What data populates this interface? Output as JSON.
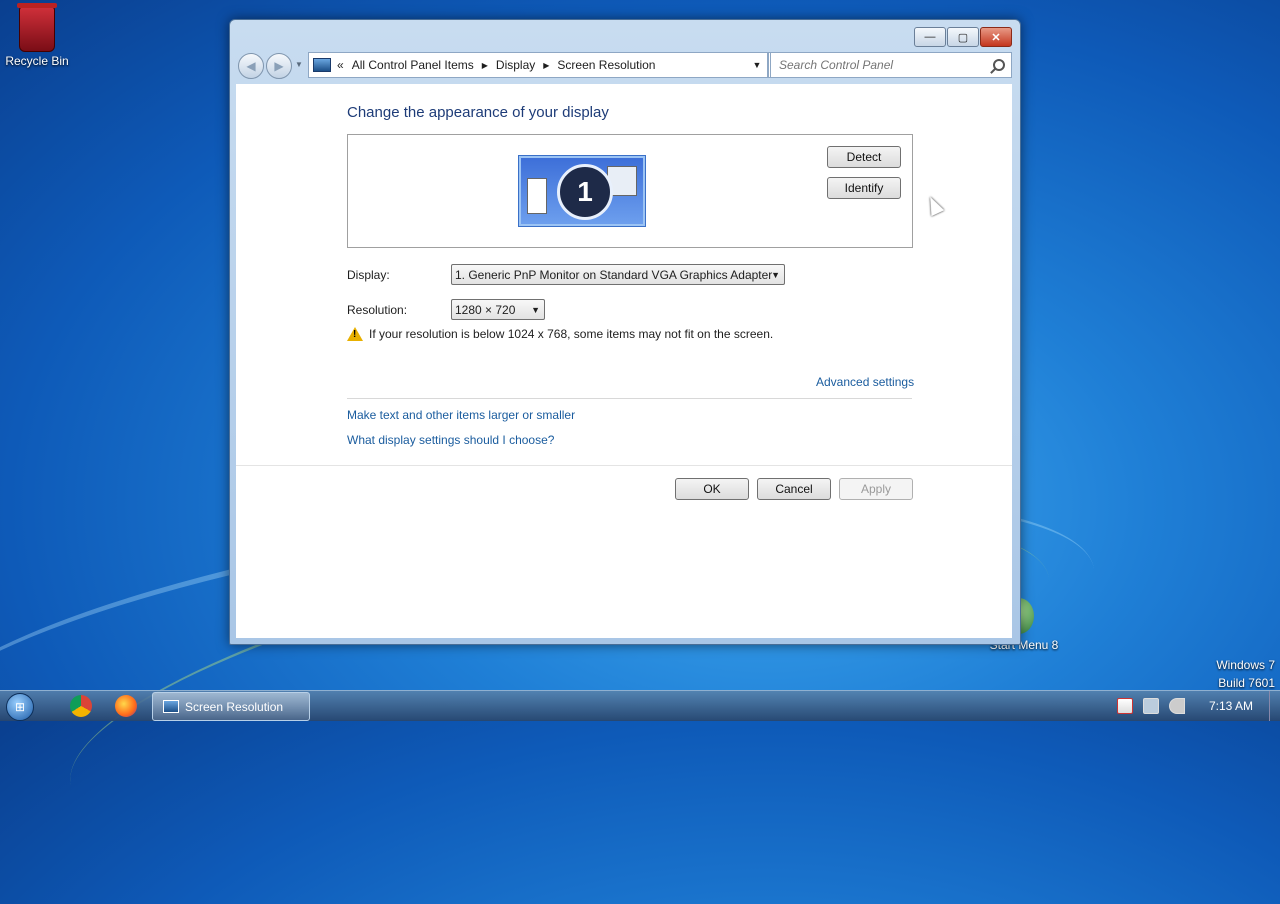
{
  "desktop": {
    "recycle_bin_label": "Recycle Bin",
    "start_menu_label": "Start Menu 8",
    "os_name": "Windows 7",
    "os_build": "Build 7601"
  },
  "window": {
    "caption_buttons": {
      "minimize": "—",
      "maximize": "▢",
      "close": "✕"
    },
    "address": {
      "prefix": "«",
      "segments": [
        "All Control Panel Items",
        "Display",
        "Screen Resolution"
      ]
    },
    "search_placeholder": "Search Control Panel"
  },
  "page": {
    "heading": "Change the appearance of your display",
    "monitor_number": "1",
    "detect_label": "Detect",
    "identify_label": "Identify",
    "display_label": "Display:",
    "display_value": "1. Generic PnP Monitor on Standard VGA Graphics Adapter",
    "resolution_label": "Resolution:",
    "resolution_value": "1280 × 720",
    "warning_text": "If your resolution is below 1024 x 768, some items may not fit on the screen.",
    "advanced_link": "Advanced settings",
    "link_text_size": "Make text and other items larger or smaller",
    "link_help": "What display settings should I choose?",
    "ok_label": "OK",
    "cancel_label": "Cancel",
    "apply_label": "Apply"
  },
  "taskbar": {
    "active_task_label": "Screen Resolution",
    "clock": "7:13 AM"
  },
  "colors": {
    "link": "#1a5c9e",
    "heading": "#1e3c78",
    "desktop_blue": "#1f7fd6"
  }
}
